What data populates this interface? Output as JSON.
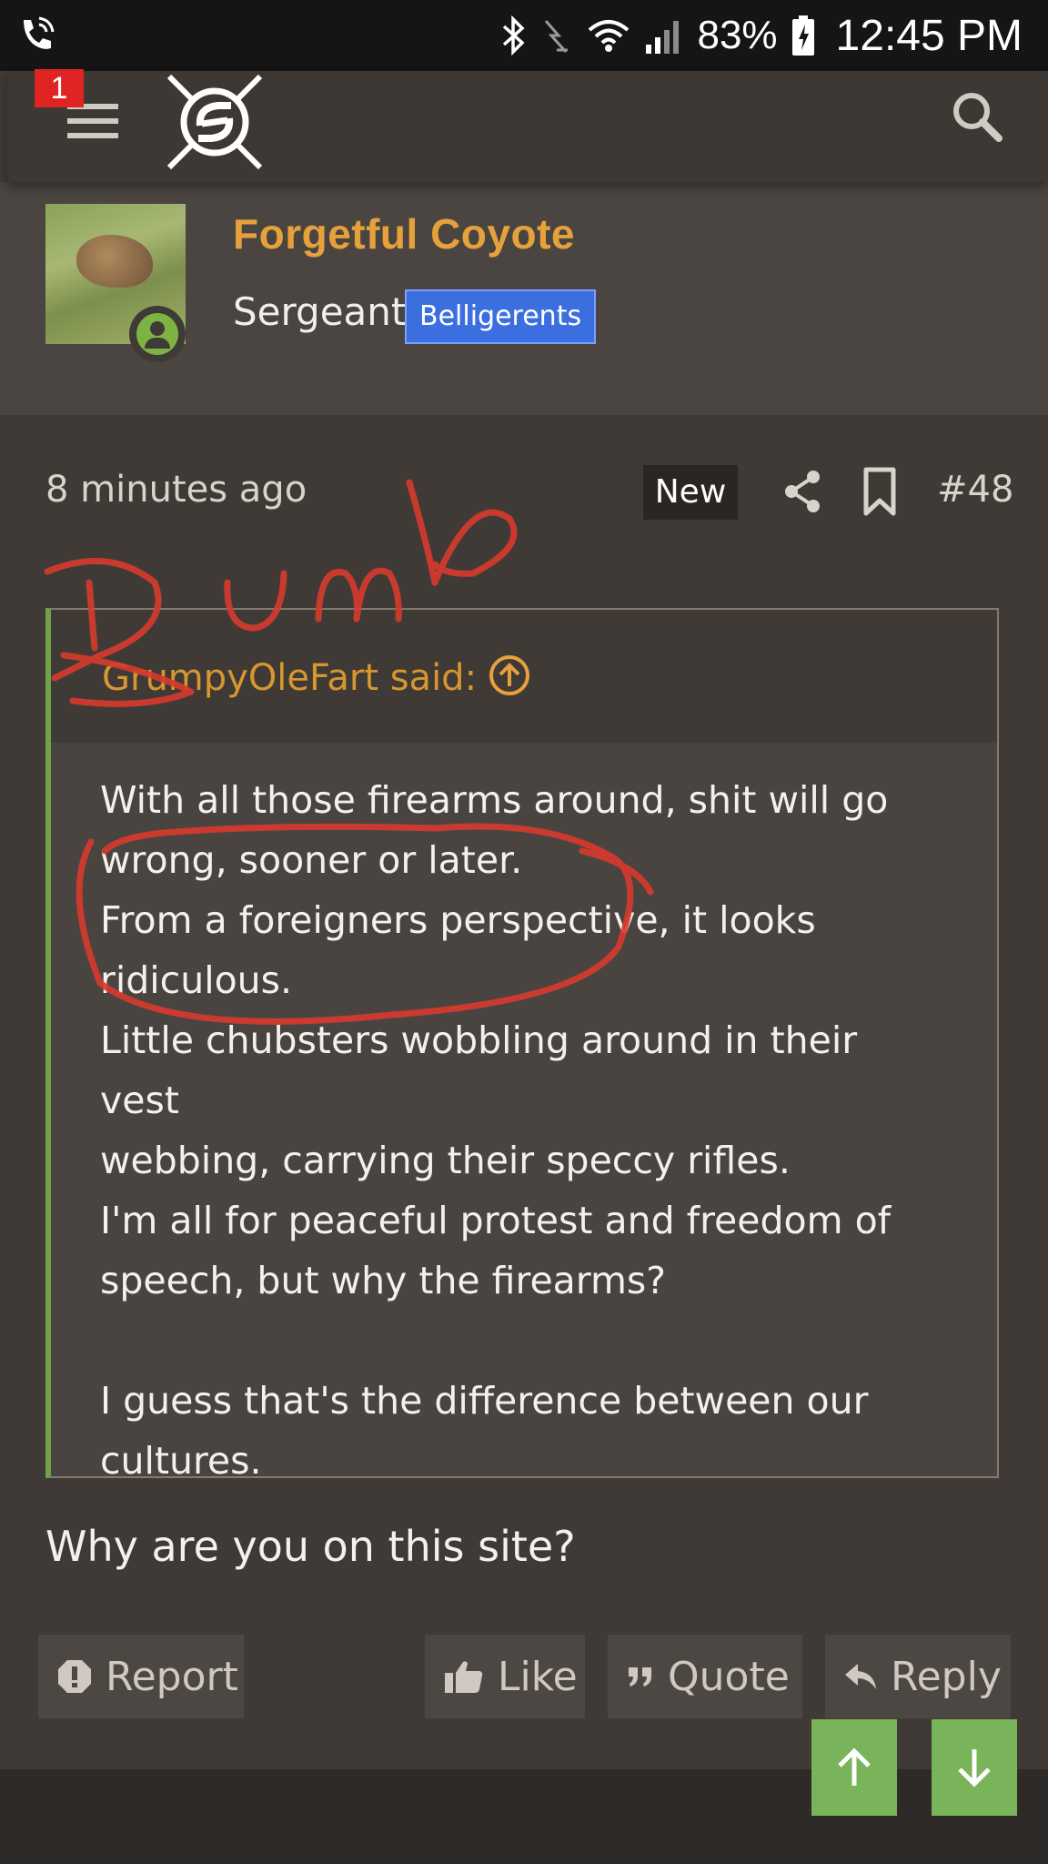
{
  "status_bar": {
    "battery": "83%",
    "time": "12:45 PM",
    "icons": [
      "phone-call-icon",
      "bluetooth-icon",
      "data-saver-icon",
      "wifi-icon",
      "signal-icon",
      "battery-charging-icon"
    ]
  },
  "app_bar": {
    "notification_count": "1",
    "icons": [
      "menu-icon",
      "site-logo",
      "search-icon"
    ]
  },
  "profile": {
    "username": "Forgetful Coyote",
    "rank": "Sergeant",
    "group_badge": "Belligerents",
    "status": "online",
    "accent_color": "#e6a13c",
    "badge_color": "#3b6fe0",
    "online_color": "#7cb342"
  },
  "post": {
    "time": "8 minutes ago",
    "new_label": "New",
    "post_number": "#48",
    "quote": {
      "author": "GrumpyOleFart said:",
      "lines": [
        "With all those firearms around, shit will go",
        "wrong, sooner or later.",
        "From a foreigners perspective, it looks",
        "ridiculous.",
        "Little chubsters wobbling around in their vest",
        "webbing, carrying their speccy rifles.",
        "I'm all for peaceful protest and freedom of",
        "speech, but why the firearms?",
        "",
        "I guess that's the difference between our",
        "cultures."
      ]
    },
    "message": "Why are you on this site?"
  },
  "actions": {
    "report": "Report",
    "like": "Like",
    "quote": "Quote",
    "reply": "Reply"
  },
  "scroll_buttons": [
    "arrow-up-icon",
    "arrow-down-icon"
  ],
  "annotation": {
    "handwritten_text": "Dumb",
    "color": "#d83a2e"
  }
}
